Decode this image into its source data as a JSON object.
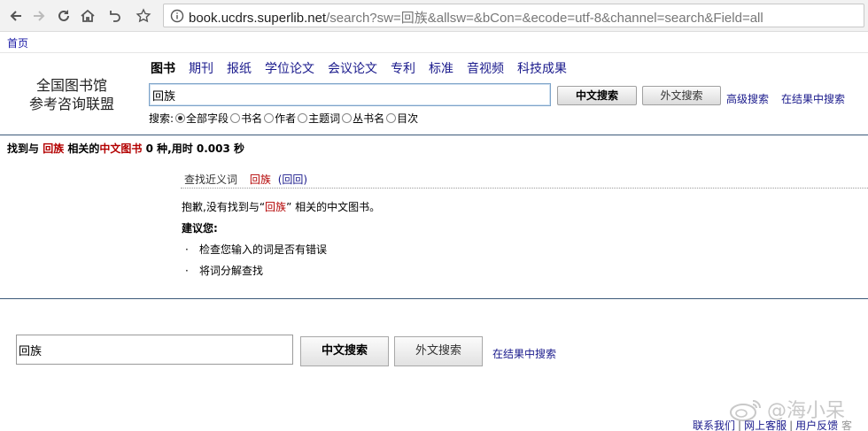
{
  "browser": {
    "url_host": "book.ucdrs.superlib.net",
    "url_path": "/search?sw=回族&allsw=&bCon=&ecode=utf-8&channel=search&Field=all"
  },
  "nav": {
    "home": "首页"
  },
  "logo": {
    "line1": "全国图书馆",
    "line2": "参考咨询联盟"
  },
  "tabs": [
    "图书",
    "期刊",
    "报纸",
    "学位论文",
    "会议论文",
    "专利",
    "标准",
    "音视频",
    "科技成果"
  ],
  "search": {
    "query": "回族",
    "cn_button": "中文搜索",
    "foreign_button": "外文搜索",
    "advanced_link": "高级搜索",
    "in_results_link": "在结果中搜索",
    "field_label": "搜索:",
    "fields": [
      "全部字段",
      "书名",
      "作者",
      "主题词",
      "丛书名",
      "目次"
    ],
    "selected_field": "全部字段"
  },
  "summary": {
    "prefix": "找到与",
    "keyword": "回族",
    "middle": "相关的",
    "database": "中文图书",
    "rest": "0 种,用时 0.003 秒"
  },
  "suggestions": {
    "label": "查找近义词",
    "word": "回族",
    "alt": "(回回)"
  },
  "no_result": {
    "sorry_prefix": "抱歉,没有找到与“",
    "keyword": "回族",
    "sorry_suffix": "” 相关的中文图书。",
    "advise_label": "建议您:",
    "tips": [
      "检查您输入的词是否有错误",
      "将词分解查找"
    ]
  },
  "bottom_search": {
    "query": "回族",
    "cn_button": "中文搜索",
    "foreign_button": "外文搜索",
    "in_results_link": "在结果中搜索"
  },
  "footer": {
    "links": [
      "联系我们",
      "网上客服",
      "用户反馈"
    ],
    "tail": "客"
  },
  "watermark": {
    "text": "@海小呆"
  }
}
